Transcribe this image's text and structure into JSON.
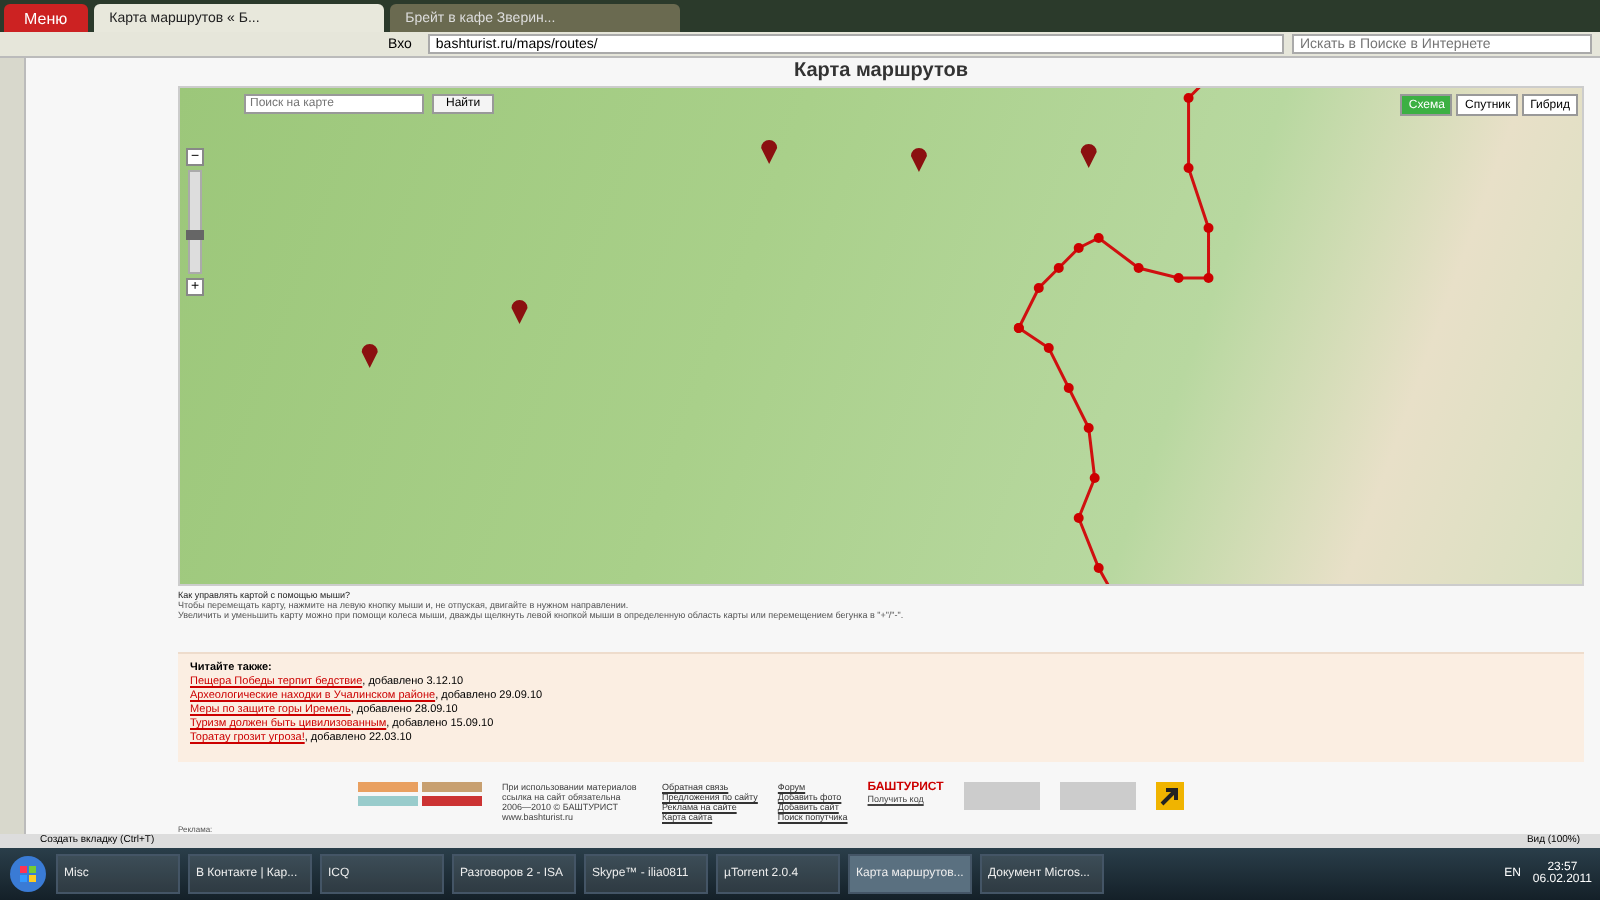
{
  "browser": {
    "menu_label": "Меню",
    "tabs": [
      {
        "label": "Карта маршрутов « Б...",
        "selected": true
      },
      {
        "label": "Брейт в кафе Зверин...",
        "selected": false
      }
    ],
    "back_label": "Вхо",
    "address": "bashturist.ru/maps/routes/",
    "search_placeholder": "Искать в Поиске в Интернете"
  },
  "page": {
    "title": "Карта маршрутов",
    "map": {
      "search_placeholder": "Поиск на карте",
      "search_button": "Найти",
      "types": [
        {
          "label": "Схема",
          "selected": true
        },
        {
          "label": "Спутник",
          "selected": false
        },
        {
          "label": "Гибрид",
          "selected": false
        }
      ],
      "zoom_in": "+",
      "zoom_out": "−",
      "zoom": {
        "level": 0.35
      }
    },
    "help": [
      "Как управлять картой с помощью мыши?",
      "Чтобы перемещать карту, нажмите на левую кнопку мыши и, не отпуская, двигайте в нужном направлении.",
      "Увеличить и уменьшить карту можно при помощи колеса мыши, дважды щелкнуть левой кнопкой мыши в определенную область карты или перемещением бегунка в \"+\"/\"-\"."
    ],
    "read_also": {
      "heading": "Читайте также:",
      "items": [
        {
          "title": "Пещера Победы терпит бедствие",
          "date": ", добавлено 3.12.10"
        },
        {
          "title": "Археологические находки в Учалинском районе",
          "date": ", добавлено 29.09.10"
        },
        {
          "title": "Меры по защите горы Иремель",
          "date": ", добавлено 28.09.10"
        },
        {
          "title": "Туризм должен быть цивилизованным",
          "date": ", добавлено 15.09.10"
        },
        {
          "title": "Торатау грозит угроза!",
          "date": ", добавлено 22.03.10"
        }
      ]
    },
    "footer": {
      "copyright": "При использовании материалов ссылка на сайт обязательна 2006—2010 © БАШТУРИСТ www.bashturist.ru",
      "links_1": [
        "Обратная связь",
        "Предложения по сайту",
        "Реклама на сайте",
        "Карта сайта"
      ],
      "links_2": [
        "Форум",
        "Добавить фото",
        "Добавить сайт",
        "Поиск попутчика"
      ],
      "logo": "БАШТУРИСТ",
      "get_code": "Получить код"
    },
    "ad_label": "Реклама:"
  },
  "status_bar": {
    "new_tab": "Создать вкладку (Ctrl+T)",
    "zoom": "Вид (100%)"
  },
  "taskbar": {
    "items": [
      {
        "label": "Misc",
        "selected": false
      },
      {
        "label": "В Контакте | Кар...",
        "selected": false
      },
      {
        "label": "ICQ",
        "selected": false
      },
      {
        "label": "Разговоров 2 - ISA",
        "selected": false
      },
      {
        "label": "Skype™ - ilia0811",
        "selected": false
      },
      {
        "label": "µTorrent 2.0.4",
        "selected": false
      },
      {
        "label": "Карта маршрутов...",
        "selected": true
      },
      {
        "label": "Документ Micros...",
        "selected": false
      }
    ],
    "lang": "EN",
    "time": "23:57",
    "date": "06.02.2011"
  }
}
